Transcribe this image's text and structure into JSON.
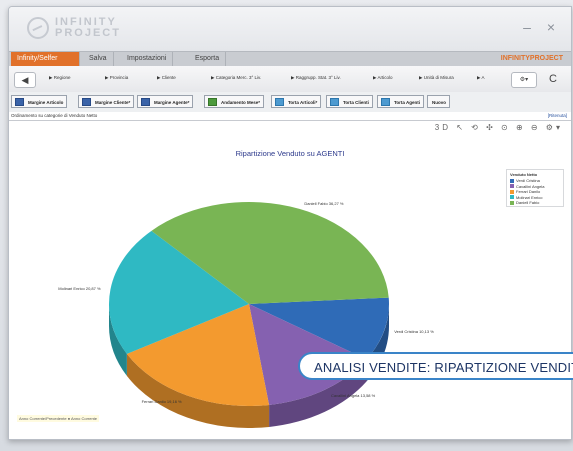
{
  "app": {
    "brand_line1": "INFINITY",
    "brand_line2": "PROJECT",
    "window_controls": "– ×",
    "brand_right": "INFINITYPROJECT"
  },
  "menu": [
    {
      "label": "Infinity/Selfer"
    },
    {
      "label": "Salva"
    },
    {
      "label": "Impostazioni"
    },
    {
      "label": "Esporta"
    }
  ],
  "nav": {
    "back": "◀",
    "items": [
      "Regione",
      "Provincia",
      "Cliente",
      "Categoria Merc. 3° Liv.",
      "Raggrupp. Stat. 3° Liv.",
      "Articolo",
      "Unità di Misura",
      "A"
    ],
    "settings": "⚙▾",
    "refresh": "C"
  },
  "tabs": [
    {
      "label": "Margine Articolo"
    },
    {
      "label": "Margine Cliente*"
    },
    {
      "label": "Margine Agente*"
    },
    {
      "label": "Andamento Mese*"
    },
    {
      "label": "Torta Articoli*"
    },
    {
      "label": "Torta Clienti"
    },
    {
      "label": "Torta Agenti"
    },
    {
      "label": "Nuovo"
    }
  ],
  "crumb": {
    "text": "Ordinamento su categorie di Venduto Netto",
    "right": "[Ritenuta]"
  },
  "tools": {
    "text": "3D ↖ ⟲ ✣ ⊙ ⊕ ⊖ ⚙▾"
  },
  "chart_data": {
    "type": "pie",
    "title": "Ripartizione Venduto su AGENTI",
    "legend_title": "Venduto Netto",
    "legend_position": "right",
    "three_d": true,
    "slices": [
      {
        "name": "Verdi Cristina",
        "value": 10.13,
        "label": "Verdi Cristina 10,13 %",
        "color": "#2f6bb7"
      },
      {
        "name": "Cavallini Angela",
        "value": 13.58,
        "label": "Cavallini Angela 13,58 %",
        "color": "#8561b0"
      },
      {
        "name": "Ferrari Danilo",
        "value": 19.16,
        "label": "Ferrari Danilo 19,16 %",
        "color": "#f39a2f"
      },
      {
        "name": "Molinari Enrico",
        "value": 20.87,
        "label": "Molinari Enrico 20,87 %",
        "color": "#2fb9c3"
      },
      {
        "name": "Daniell Fabio",
        "value": 36.27,
        "label": "Daniell Fabio 36,27 %",
        "color": "#79b554"
      }
    ]
  },
  "footer_legend": "Anno Corrente/Precedente ● Anno Corrente",
  "banner": "ANALISI VENDITE: RIPARTIZIONE VENDITE"
}
